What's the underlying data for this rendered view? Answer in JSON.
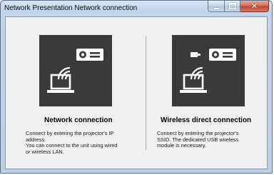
{
  "window": {
    "title": "Network Presentation Network connection"
  },
  "options": [
    {
      "title": "Network connection",
      "icon": "network-connection-icon",
      "description": [
        "Connect by entering the projector's IP",
        "address.",
        "You can connect to the unit using wired",
        "or wireless LAN."
      ]
    },
    {
      "title": "Wireless direct connection",
      "icon": "wireless-direct-connection-icon",
      "description": [
        "Connect by entering the projector's",
        "SSID. The dedicated USB wireless",
        "module is necessary."
      ]
    }
  ],
  "colors": {
    "tile_bg": "#3a3a3a",
    "close_button": "#c2432b",
    "frame": "#bcd0e8"
  }
}
